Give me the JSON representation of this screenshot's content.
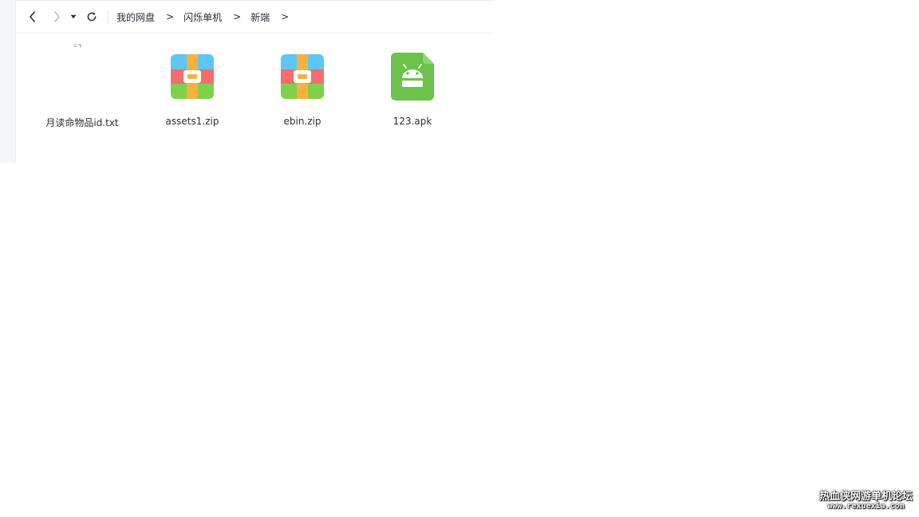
{
  "breadcrumb": {
    "items": [
      "我的网盘",
      "闪烁单机",
      "新端"
    ],
    "separator": ">"
  },
  "toolbar": {
    "back_icon": "chevron-left-icon",
    "forward_icon": "chevron-right-icon",
    "history_icon": "caret-down-icon",
    "refresh_icon": "refresh-icon"
  },
  "files": [
    {
      "name": "月读命物品id.txt",
      "type": "txt",
      "icon": "text-file-icon",
      "thumb_text": "三飞"
    },
    {
      "name": "assets1.zip",
      "type": "zip",
      "icon": "zip-archive-icon"
    },
    {
      "name": "ebin.zip",
      "type": "zip",
      "icon": "zip-archive-icon"
    },
    {
      "name": "123.apk",
      "type": "apk",
      "icon": "android-apk-icon"
    }
  ],
  "watermark": {
    "line1": "热血侠网游单机论坛",
    "line2": "www.rexuexia.com"
  },
  "colors": {
    "zip_top": "#5ec6f5",
    "zip_mid": "#f56d6d",
    "zip_bottom": "#7ed24a",
    "zip_strap": "#f8b140",
    "apk": "#6cc24a",
    "text": "#2b2f36"
  }
}
